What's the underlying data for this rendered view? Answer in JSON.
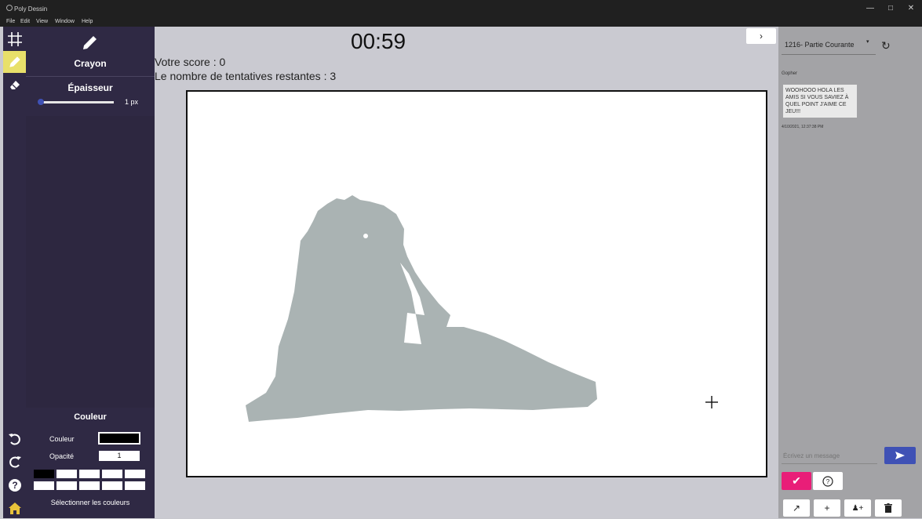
{
  "window": {
    "title": "Poly Dessin"
  },
  "menu": [
    "File",
    "Edit",
    "View",
    "Window",
    "Help"
  ],
  "tool_panel": {
    "tool_name": "Crayon",
    "thickness_label": "Épaisseur",
    "thickness_value": "1 px",
    "color_section_title": "Couleur",
    "color_label": "Couleur",
    "opacity_label": "Opacité",
    "opacity_value": "1",
    "select_colors_label": "Sélectionner les couleurs",
    "primary_color": "#000000"
  },
  "game": {
    "timer": "00:59",
    "score_text": "Votre score : 0",
    "attempts_text": "Le nombre de tentatives restantes : 3",
    "drawing_color": "#aab3b3"
  },
  "chat": {
    "channel": "1216- Partie Courante",
    "messages": [
      {
        "author": "Gopher",
        "text": "WOOHOOO HOLA LES AMIS SI VOUS SAVIEZ À QUEL POINT J'AIME CE JEU!!!",
        "timestamp": "4/10/2021, 12:37:38 PM"
      }
    ],
    "input_placeholder": "Écrivez un message",
    "accent_send": "#3f51b5",
    "accent_check": "#e91e78"
  },
  "colors": {
    "sidebar": "#2f2944",
    "workarea": "#cacad1",
    "right_panel": "#a3a3a6"
  }
}
